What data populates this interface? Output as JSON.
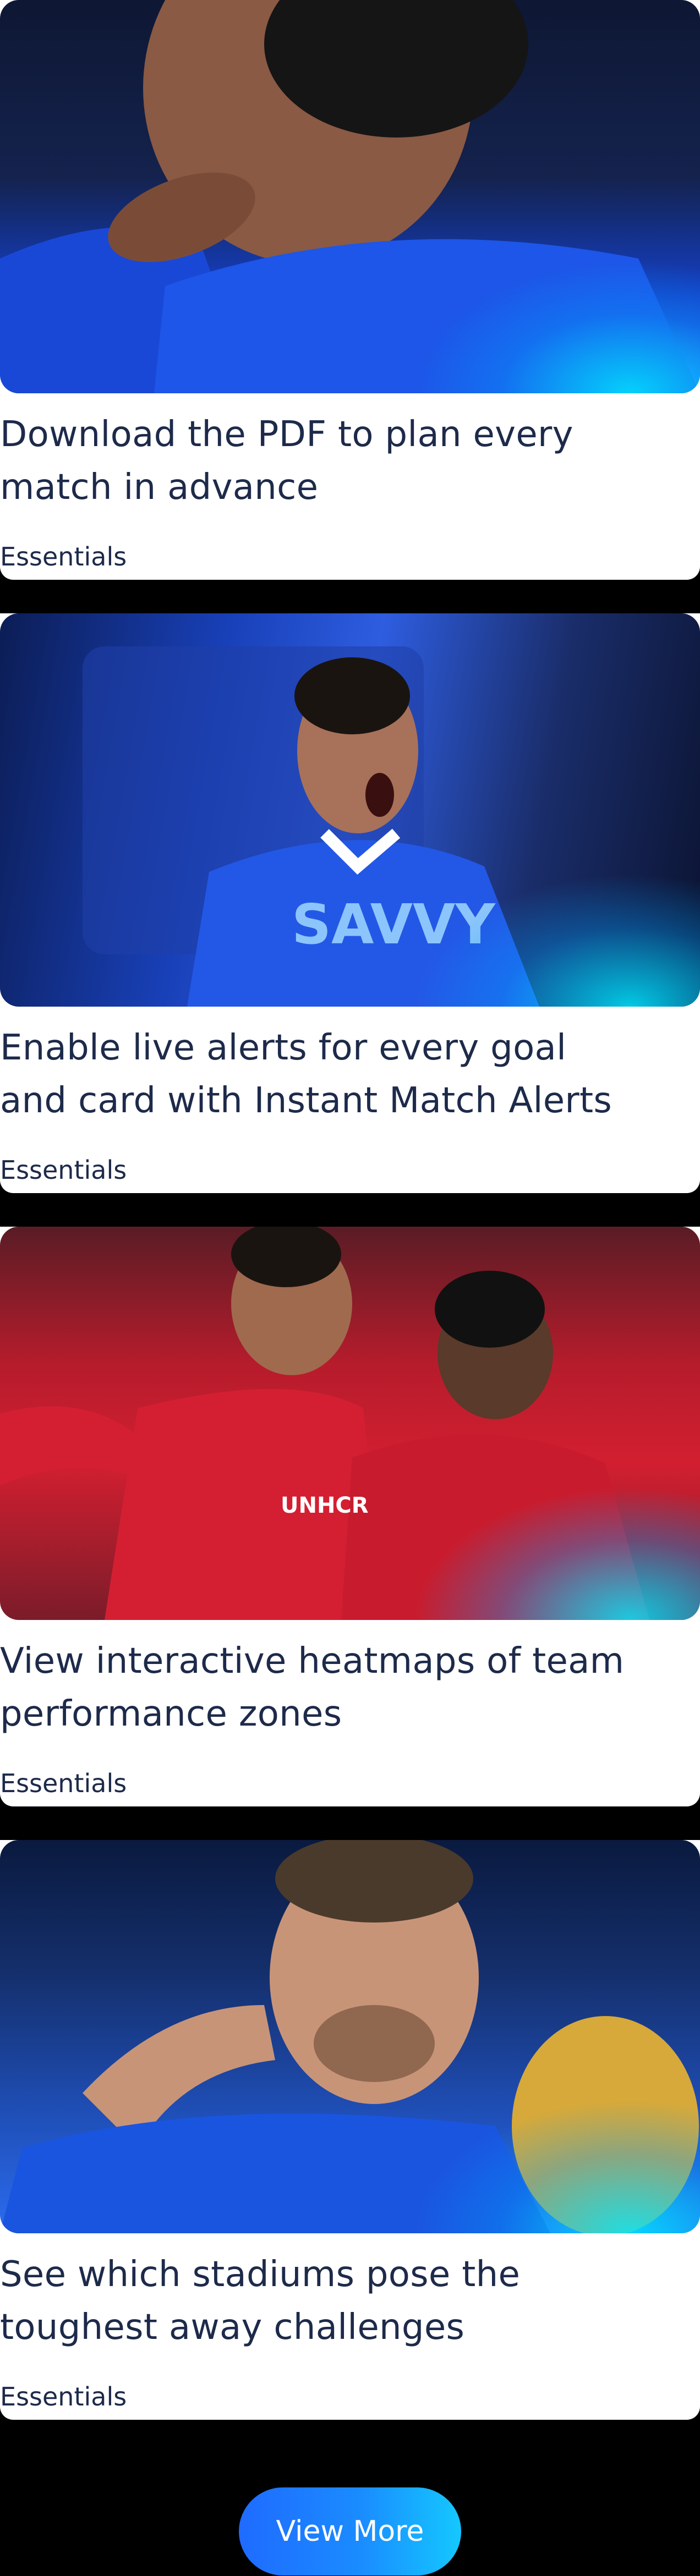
{
  "cards": [
    {
      "title": "Download the PDF to plan every match in advance",
      "tag": "Essentials",
      "image_alt": "Player resting chin on hand in blue kit"
    },
    {
      "title": "Enable live alerts for every goal and card with Instant Match Alerts",
      "tag": "Essentials",
      "image_alt": "Player celebrating in blue SAVVY kit"
    },
    {
      "title": "View interactive heatmaps of team performance zones",
      "tag": "Essentials",
      "image_alt": "Players celebrating in red UNHCR kit"
    },
    {
      "title": "See which stadiums pose the toughest away challenges",
      "tag": "Essentials",
      "image_alt": "Player with trophy gesturing mustache"
    }
  ],
  "view_more": {
    "label": "View More"
  },
  "colors": {
    "background": "#000000",
    "card": "#ffffff",
    "text": "#1d2a4a",
    "accent_start": "#1f6bff",
    "accent_end": "#14c8ff"
  }
}
